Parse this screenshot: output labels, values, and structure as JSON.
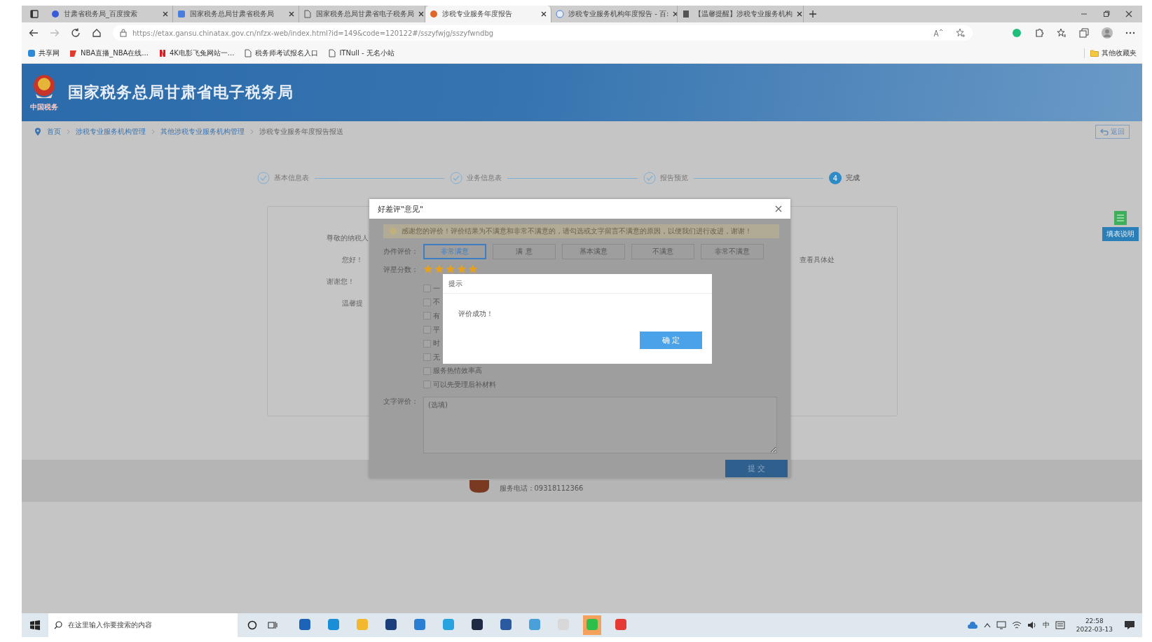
{
  "browser": {
    "tabs": [
      {
        "title": "甘肃省税务局_百度搜索",
        "selected": false
      },
      {
        "title": "国家税务总局甘肃省税务局",
        "selected": false
      },
      {
        "title": "国家税务总局甘肃省电子税务局",
        "selected": false
      },
      {
        "title": "涉税专业服务年度报告",
        "selected": true
      },
      {
        "title": "涉税专业服务机构年度报告 - 百:",
        "selected": false
      },
      {
        "title": "【温馨提醒】涉税专业服务机构",
        "selected": false
      }
    ],
    "url": "https://etax.gansu.chinatax.gov.cn/nfzx-web/index.html?id=149&code=120122#/sszyfwjg/sszyfwndbg",
    "bookmarks": [
      {
        "label": "共享网",
        "kind": "site"
      },
      {
        "label": "NBA直播_NBA在线...",
        "kind": "sport"
      },
      {
        "label": "4K电影飞兔网站一...",
        "kind": "video"
      },
      {
        "label": "税务师考试报名入口",
        "kind": "page"
      },
      {
        "label": "ITNull - 无名小站",
        "kind": "page"
      }
    ],
    "other_bookmarks": "其他收藏夹"
  },
  "site": {
    "logo_caption": "中国税务",
    "title": "国家税务总局甘肃省电子税务局",
    "breadcrumb": [
      {
        "label": "首页",
        "kind": "link"
      },
      {
        "label": "涉税专业服务机构管理",
        "kind": "link"
      },
      {
        "label": "其他涉税专业服务机构管理",
        "kind": "link"
      },
      {
        "label": "涉税专业服务年度报告报送",
        "kind": "current"
      }
    ],
    "back_button": "返回",
    "steps": [
      {
        "label": "基本信息表",
        "kind": "done"
      },
      {
        "label": "业务信息表",
        "kind": "done"
      },
      {
        "label": "报告预览",
        "kind": "done"
      },
      {
        "label": "完成",
        "kind": "current",
        "number": "4"
      }
    ],
    "card_texts": [
      "尊敬的纳税人",
      "您好！",
      "查看具体处",
      "谢谢您！",
      "温馨提"
    ],
    "help_button": "填表说明",
    "footer_phone": "服务电话：09318112366"
  },
  "evaluation_dialog": {
    "title": "好差评\"意见\"",
    "notice": "感谢您的评价！评价结果为不满意和非常不满意的，请勾选或文字留言不满意的原因，以便我们进行改进，谢谢！",
    "rating_label": "办件评价：",
    "ratings": [
      {
        "label": "非常满意",
        "selected": true
      },
      {
        "label": "满 意",
        "selected": false
      },
      {
        "label": "基本满意",
        "selected": false
      },
      {
        "label": "不满意",
        "selected": false
      },
      {
        "label": "非常不满意",
        "selected": false
      }
    ],
    "score_label": "评星分数：",
    "stars": 5,
    "reasons": [
      {
        "label": "一",
        "checked": false
      },
      {
        "label": "不",
        "checked": false
      },
      {
        "label": "有",
        "checked": false
      },
      {
        "label": "平",
        "checked": false
      },
      {
        "label": "时",
        "checked": false
      },
      {
        "label": "无",
        "checked": false
      },
      {
        "label": "服务热情效率高",
        "checked": false
      },
      {
        "label": "可以先受理后补材料",
        "checked": false
      }
    ],
    "comment_label": "文字评价：",
    "comment_placeholder": "(选填)",
    "submit": "提 交"
  },
  "alert_dialog": {
    "title": "提示",
    "message": "评价成功！",
    "ok": "确 定"
  },
  "taskbar": {
    "search_placeholder": "在这里输入你要搜索的内容",
    "ime": "中",
    "time": "22:58",
    "date": "2022-03-13"
  }
}
